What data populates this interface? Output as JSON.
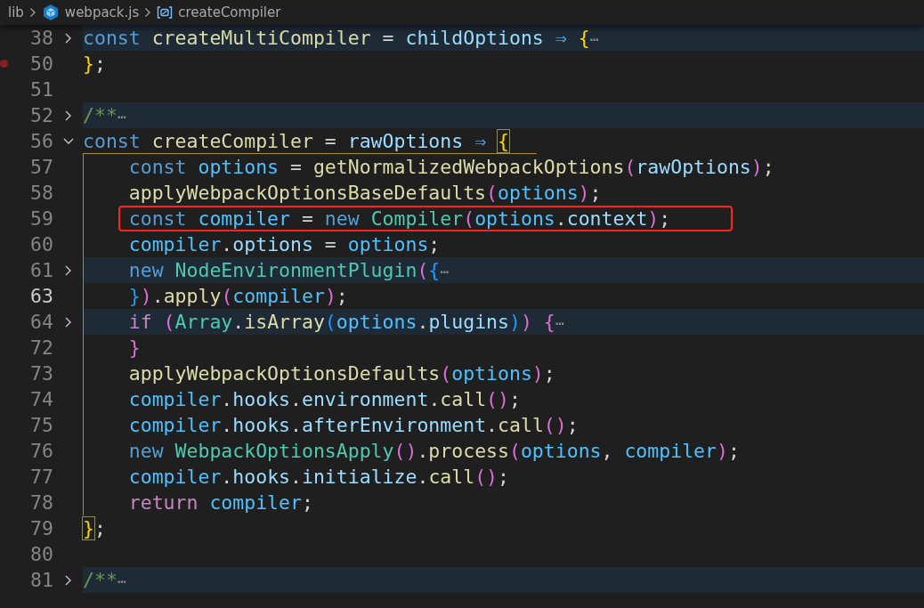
{
  "breadcrumb": [
    {
      "kind": "folder",
      "label": "lib"
    },
    {
      "kind": "file",
      "label": "webpack.js"
    },
    {
      "kind": "variable",
      "label": "createCompiler"
    }
  ],
  "lines": [
    {
      "number": "38",
      "expanded": false,
      "breakpoint": false,
      "current": false,
      "annotated": false,
      "tokens": [
        {
          "text": "const ",
          "kind": "keyword"
        },
        {
          "text": "createMultiCompiler",
          "kind": "function"
        },
        {
          "text": " = ",
          "kind": "operator"
        },
        {
          "text": "childOptions",
          "kind": "property"
        },
        {
          "text": " ⇒ ",
          "kind": "keyword"
        },
        {
          "text": "{",
          "kind": "bracket-gold"
        },
        {
          "text": "⋯",
          "kind": "fold-ellipsis"
        }
      ]
    },
    {
      "number": "50",
      "breakpoint": true,
      "current": false,
      "annotated": false,
      "tokens": [
        {
          "text": "}",
          "kind": "bracket-gold"
        },
        {
          "text": ";",
          "kind": "punct"
        }
      ]
    },
    {
      "number": "51",
      "breakpoint": false,
      "current": false,
      "annotated": false
    },
    {
      "number": "52",
      "expanded": false,
      "breakpoint": false,
      "current": false,
      "annotated": false,
      "tokens": [
        {
          "text": "/**",
          "kind": "comment"
        },
        {
          "text": "⋯",
          "kind": "fold-ellipsis"
        }
      ]
    },
    {
      "number": "56",
      "expanded": true,
      "breakpoint": false,
      "current": false,
      "annotated": false,
      "tokens": [
        {
          "text": "const ",
          "kind": "keyword"
        },
        {
          "text": "createCompiler",
          "kind": "function"
        },
        {
          "text": " = ",
          "kind": "operator"
        },
        {
          "text": "rawOptions",
          "kind": "property"
        },
        {
          "text": " ⇒ ",
          "kind": "keyword"
        },
        {
          "text": "{",
          "kind": "bracket-gold-match"
        }
      ]
    },
    {
      "number": "57",
      "breakpoint": false,
      "current": false,
      "annotated": false,
      "tokens": [
        {
          "text": "    const ",
          "kind": "keyword"
        },
        {
          "text": "options",
          "kind": "variable"
        },
        {
          "text": " = ",
          "kind": "operator"
        },
        {
          "text": "getNormalizedWebpackOptions",
          "kind": "function"
        },
        {
          "text": "(",
          "kind": "bracket-pink"
        },
        {
          "text": "rawOptions",
          "kind": "property"
        },
        {
          "text": ")",
          "kind": "bracket-pink"
        },
        {
          "text": ";",
          "kind": "punct"
        }
      ]
    },
    {
      "number": "58",
      "breakpoint": false,
      "current": false,
      "annotated": false,
      "tokens": [
        {
          "text": "    applyWebpackOptionsBaseDefaults",
          "kind": "function"
        },
        {
          "text": "(",
          "kind": "bracket-pink"
        },
        {
          "text": "options",
          "kind": "variable"
        },
        {
          "text": ")",
          "kind": "bracket-pink"
        },
        {
          "text": ";",
          "kind": "punct"
        }
      ]
    },
    {
      "number": "59",
      "breakpoint": false,
      "current": false,
      "annotated": true,
      "tokens": [
        {
          "text": "    const ",
          "kind": "keyword"
        },
        {
          "text": "compiler",
          "kind": "variable"
        },
        {
          "text": " = ",
          "kind": "operator"
        },
        {
          "text": "new ",
          "kind": "keyword"
        },
        {
          "text": "Compiler",
          "kind": "class"
        },
        {
          "text": "(",
          "kind": "bracket-pink"
        },
        {
          "text": "options",
          "kind": "variable"
        },
        {
          "text": ".",
          "kind": "punct"
        },
        {
          "text": "context",
          "kind": "property"
        },
        {
          "text": ")",
          "kind": "bracket-pink"
        },
        {
          "text": ";",
          "kind": "punct"
        }
      ]
    },
    {
      "number": "60",
      "breakpoint": false,
      "current": false,
      "annotated": false,
      "tokens": [
        {
          "text": "    compiler",
          "kind": "variable"
        },
        {
          "text": ".",
          "kind": "punct"
        },
        {
          "text": "options",
          "kind": "property"
        },
        {
          "text": " = ",
          "kind": "operator"
        },
        {
          "text": "options",
          "kind": "variable"
        },
        {
          "text": ";",
          "kind": "punct"
        }
      ]
    },
    {
      "number": "61",
      "expanded": false,
      "breakpoint": false,
      "current": false,
      "annotated": false,
      "tokens": [
        {
          "text": "    new ",
          "kind": "keyword"
        },
        {
          "text": "NodeEnvironmentPlugin",
          "kind": "class"
        },
        {
          "text": "(",
          "kind": "bracket-pink"
        },
        {
          "text": "{",
          "kind": "bracket-blue"
        },
        {
          "text": "⋯",
          "kind": "fold-ellipsis"
        }
      ]
    },
    {
      "number": "63",
      "breakpoint": false,
      "current": true,
      "annotated": false,
      "tokens": [
        {
          "text": "    }",
          "kind": "bracket-blue"
        },
        {
          "text": ")",
          "kind": "bracket-pink"
        },
        {
          "text": ".",
          "kind": "punct"
        },
        {
          "text": "apply",
          "kind": "function"
        },
        {
          "text": "(",
          "kind": "bracket-pink"
        },
        {
          "text": "compiler",
          "kind": "variable"
        },
        {
          "text": ")",
          "kind": "bracket-pink"
        },
        {
          "text": ";",
          "kind": "punct"
        }
      ]
    },
    {
      "number": "64",
      "expanded": false,
      "breakpoint": false,
      "current": false,
      "annotated": false,
      "tokens": [
        {
          "text": "    if ",
          "kind": "control"
        },
        {
          "text": "(",
          "kind": "bracket-pink"
        },
        {
          "text": "Array",
          "kind": "class"
        },
        {
          "text": ".",
          "kind": "punct"
        },
        {
          "text": "isArray",
          "kind": "function"
        },
        {
          "text": "(",
          "kind": "bracket-blue"
        },
        {
          "text": "options",
          "kind": "variable"
        },
        {
          "text": ".",
          "kind": "punct"
        },
        {
          "text": "plugins",
          "kind": "property"
        },
        {
          "text": ")",
          "kind": "bracket-blue"
        },
        {
          "text": ") ",
          "kind": "bracket-pink"
        },
        {
          "text": "{",
          "kind": "bracket-pink"
        },
        {
          "text": "⋯",
          "kind": "fold-ellipsis"
        }
      ]
    },
    {
      "number": "72",
      "breakpoint": false,
      "current": false,
      "annotated": false,
      "tokens": [
        {
          "text": "    }",
          "kind": "bracket-pink"
        }
      ]
    },
    {
      "number": "73",
      "breakpoint": false,
      "current": false,
      "annotated": false,
      "tokens": [
        {
          "text": "    applyWebpackOptionsDefaults",
          "kind": "function"
        },
        {
          "text": "(",
          "kind": "bracket-pink"
        },
        {
          "text": "options",
          "kind": "variable"
        },
        {
          "text": ")",
          "kind": "bracket-pink"
        },
        {
          "text": ";",
          "kind": "punct"
        }
      ]
    },
    {
      "number": "74",
      "breakpoint": false,
      "current": false,
      "annotated": false,
      "tokens": [
        {
          "text": "    compiler",
          "kind": "variable"
        },
        {
          "text": ".",
          "kind": "punct"
        },
        {
          "text": "hooks",
          "kind": "property"
        },
        {
          "text": ".",
          "kind": "punct"
        },
        {
          "text": "environment",
          "kind": "property"
        },
        {
          "text": ".",
          "kind": "punct"
        },
        {
          "text": "call",
          "kind": "function"
        },
        {
          "text": "()",
          "kind": "bracket-pink"
        },
        {
          "text": ";",
          "kind": "punct"
        }
      ]
    },
    {
      "number": "75",
      "breakpoint": false,
      "current": false,
      "annotated": false,
      "tokens": [
        {
          "text": "    compiler",
          "kind": "variable"
        },
        {
          "text": ".",
          "kind": "punct"
        },
        {
          "text": "hooks",
          "kind": "property"
        },
        {
          "text": ".",
          "kind": "punct"
        },
        {
          "text": "afterEnvironment",
          "kind": "property"
        },
        {
          "text": ".",
          "kind": "punct"
        },
        {
          "text": "call",
          "kind": "function"
        },
        {
          "text": "()",
          "kind": "bracket-pink"
        },
        {
          "text": ";",
          "kind": "punct"
        }
      ]
    },
    {
      "number": "76",
      "breakpoint": false,
      "current": false,
      "annotated": false,
      "tokens": [
        {
          "text": "    new ",
          "kind": "keyword"
        },
        {
          "text": "WebpackOptionsApply",
          "kind": "class"
        },
        {
          "text": "()",
          "kind": "bracket-pink"
        },
        {
          "text": ".",
          "kind": "punct"
        },
        {
          "text": "process",
          "kind": "function"
        },
        {
          "text": "(",
          "kind": "bracket-pink"
        },
        {
          "text": "options",
          "kind": "variable"
        },
        {
          "text": ", ",
          "kind": "punct"
        },
        {
          "text": "compiler",
          "kind": "variable"
        },
        {
          "text": ")",
          "kind": "bracket-pink"
        },
        {
          "text": ";",
          "kind": "punct"
        }
      ]
    },
    {
      "number": "77",
      "breakpoint": false,
      "current": false,
      "annotated": false,
      "tokens": [
        {
          "text": "    compiler",
          "kind": "variable"
        },
        {
          "text": ".",
          "kind": "punct"
        },
        {
          "text": "hooks",
          "kind": "property"
        },
        {
          "text": ".",
          "kind": "punct"
        },
        {
          "text": "initialize",
          "kind": "property"
        },
        {
          "text": ".",
          "kind": "punct"
        },
        {
          "text": "call",
          "kind": "function"
        },
        {
          "text": "()",
          "kind": "bracket-pink"
        },
        {
          "text": ";",
          "kind": "punct"
        }
      ]
    },
    {
      "number": "78",
      "breakpoint": false,
      "current": false,
      "annotated": false,
      "tokens": [
        {
          "text": "    return ",
          "kind": "control"
        },
        {
          "text": "compiler",
          "kind": "variable"
        },
        {
          "text": ";",
          "kind": "punct"
        }
      ]
    },
    {
      "number": "79",
      "breakpoint": false,
      "current": false,
      "annotated": false,
      "tokens": [
        {
          "text": "}",
          "kind": "bracket-gold-match"
        },
        {
          "text": ";",
          "kind": "punct"
        }
      ]
    },
    {
      "number": "80",
      "breakpoint": false,
      "current": false,
      "annotated": false
    },
    {
      "number": "81",
      "expanded": false,
      "breakpoint": false,
      "current": false,
      "annotated": false,
      "tokens": [
        {
          "text": "/**",
          "kind": "comment"
        },
        {
          "text": "⋯",
          "kind": "fold-ellipsis"
        }
      ]
    }
  ]
}
